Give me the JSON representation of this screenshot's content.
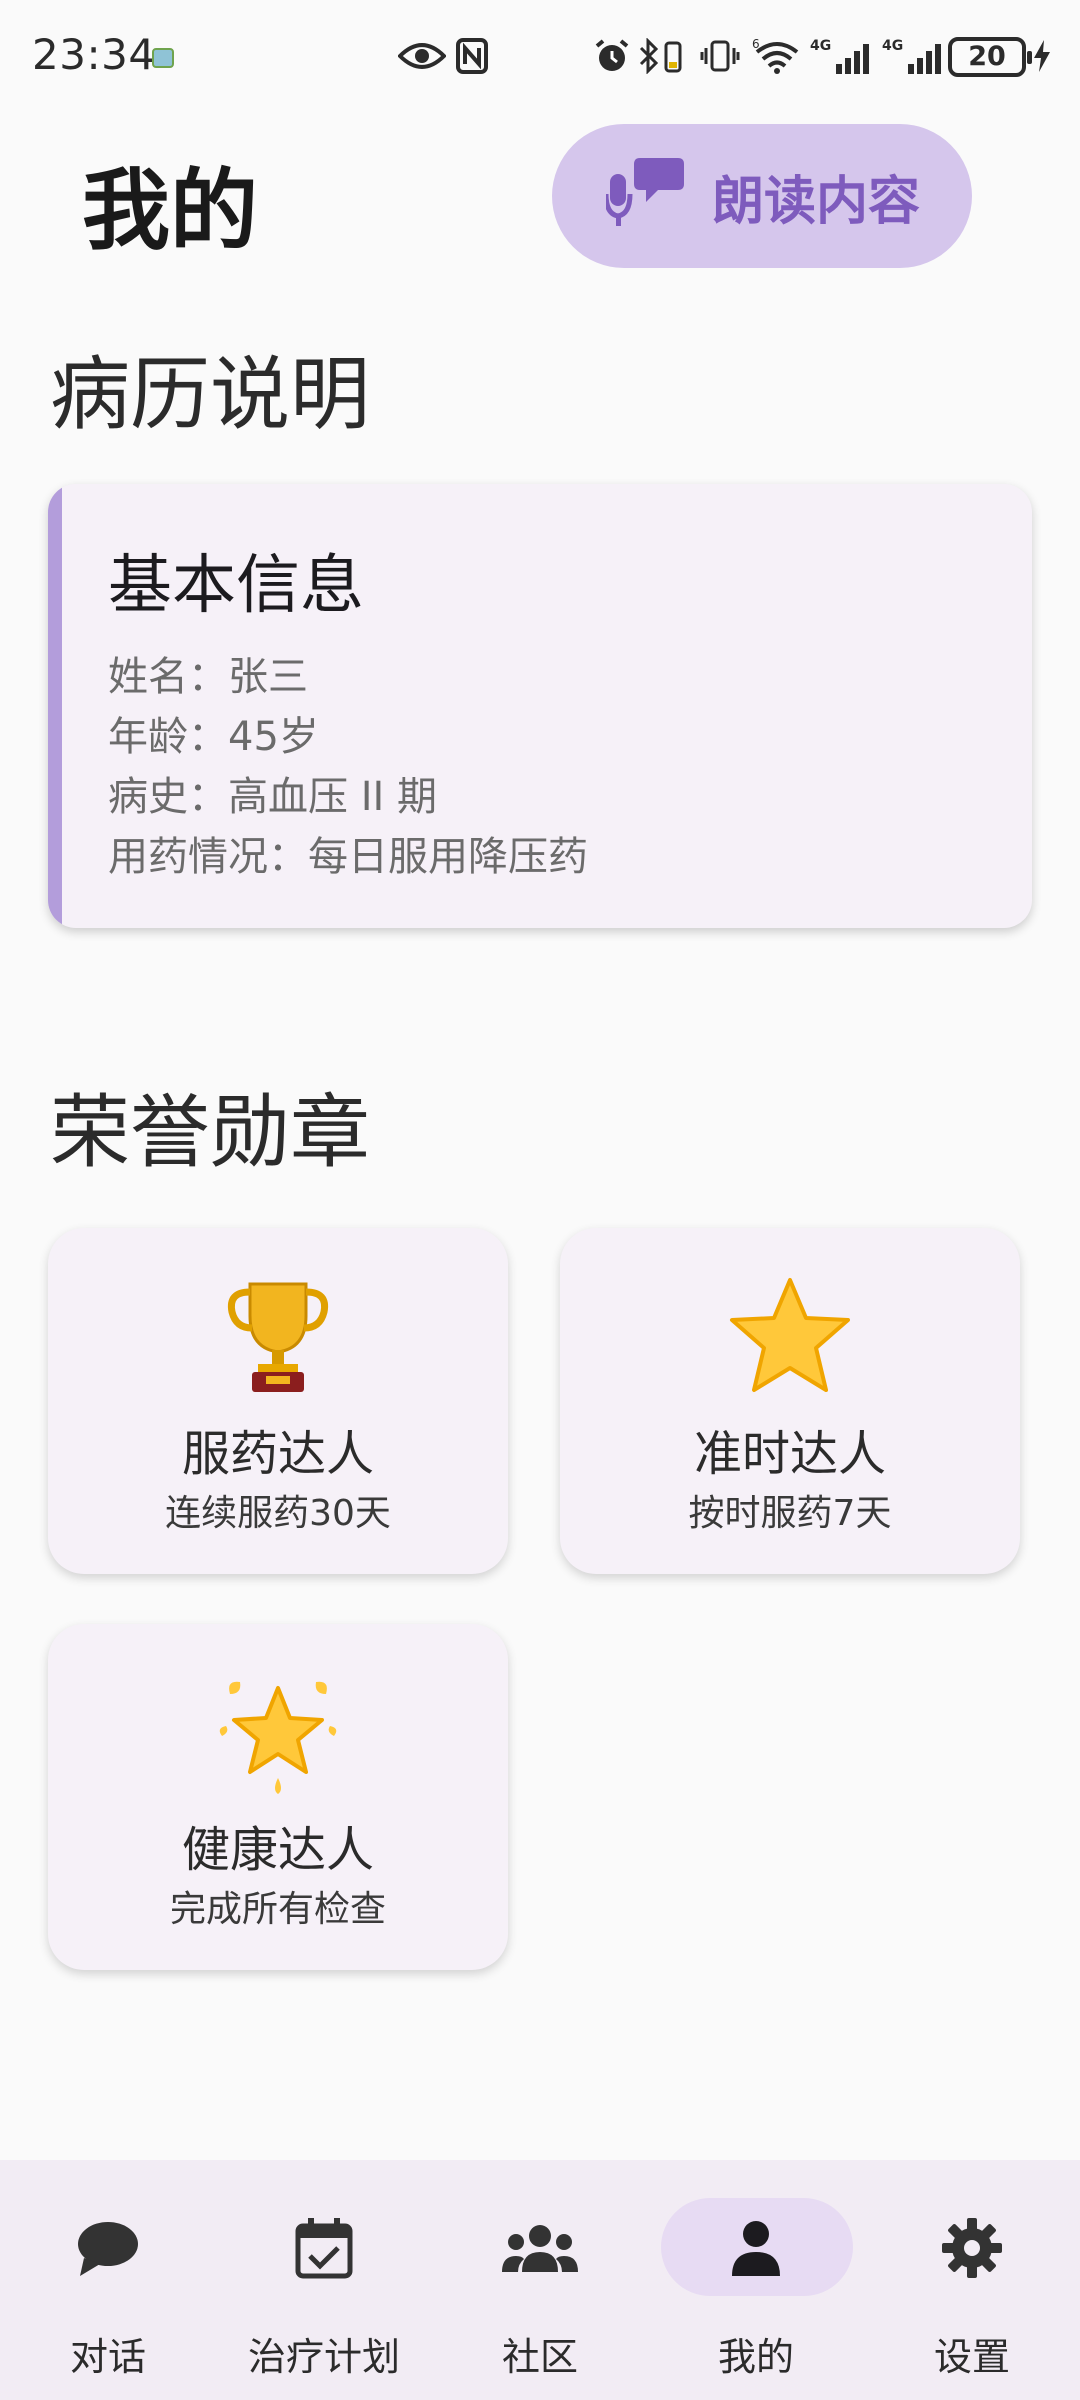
{
  "status_bar": {
    "time": "23:34",
    "battery": "20",
    "network_1": "4G",
    "network_2": "4G",
    "wifi_gen": "6"
  },
  "header": {
    "title": "我的",
    "read_button_label": "朗读内容"
  },
  "medical_section": {
    "title": "病历说明",
    "card_title": "基本信息",
    "lines": [
      "姓名：张三",
      "年龄：45岁",
      "病史：高血压 II 期",
      "用药情况：每日服用降压药"
    ]
  },
  "badges_section": {
    "title": "荣誉勋章",
    "badges": [
      {
        "name": "服药达人",
        "desc": "连续服药30天",
        "icon": "trophy-icon"
      },
      {
        "name": "准时达人",
        "desc": "按时服药7天",
        "icon": "star-icon"
      },
      {
        "name": "健康达人",
        "desc": "完成所有检查",
        "icon": "glowing-star-icon"
      }
    ]
  },
  "bottom_nav": {
    "items": [
      {
        "label": "对话",
        "icon": "chat-bubble-icon",
        "selected": false
      },
      {
        "label": "治疗计划",
        "icon": "calendar-check-icon",
        "selected": false
      },
      {
        "label": "社区",
        "icon": "people-icon",
        "selected": false
      },
      {
        "label": "我的",
        "icon": "person-icon",
        "selected": true
      },
      {
        "label": "设置",
        "icon": "gear-icon",
        "selected": false
      }
    ]
  },
  "colors": {
    "accent": "#b39ddb",
    "read_button_bg": "#d5c6ec",
    "read_button_text": "#7e5bbd",
    "nav_selected_bg": "#e7dbf3"
  }
}
